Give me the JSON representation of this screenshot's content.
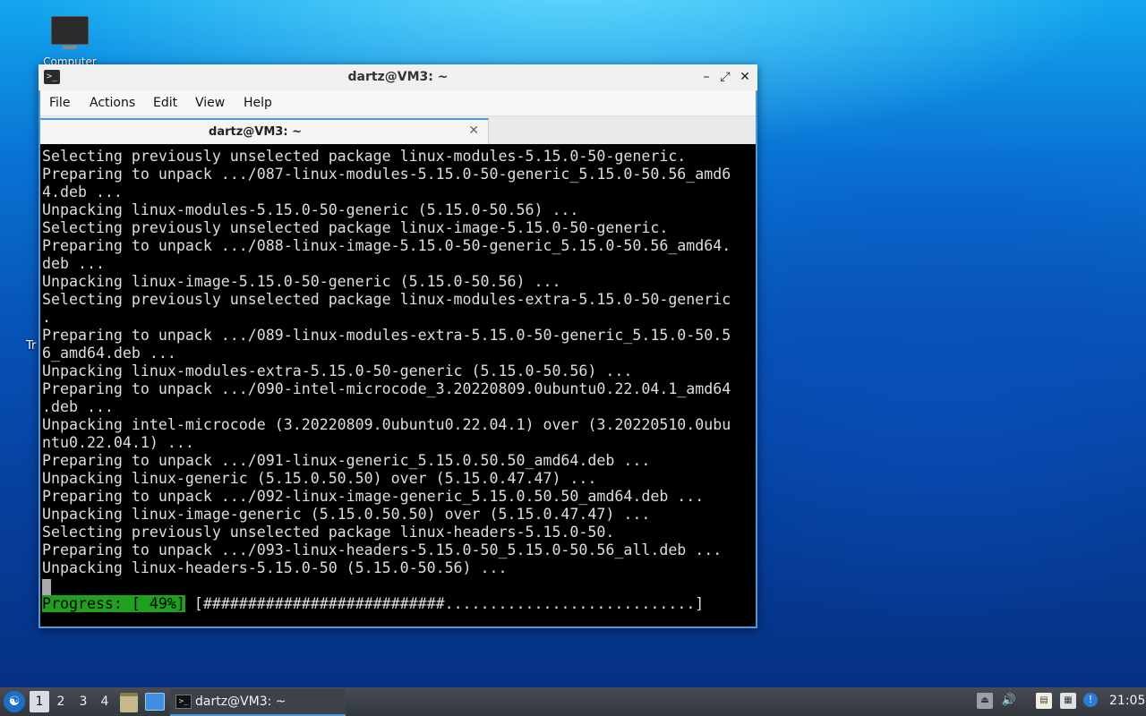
{
  "desktop": {
    "computer_label": "Computer",
    "trash_label": "Tr"
  },
  "window": {
    "title": "dartz@VM3: ~",
    "app_icon_glyph": ">_",
    "controls": {
      "minimize": "–",
      "maximize": "⤢",
      "close": "✕"
    },
    "menu": {
      "file": "File",
      "actions": "Actions",
      "edit": "Edit",
      "view": "View",
      "help": "Help"
    },
    "tab": {
      "title": "dartz@VM3: ~",
      "close": "✕"
    }
  },
  "terminal": {
    "lines": [
      "Selecting previously unselected package linux-modules-5.15.0-50-generic.",
      "Preparing to unpack .../087-linux-modules-5.15.0-50-generic_5.15.0-50.56_amd6",
      "4.deb ...",
      "Unpacking linux-modules-5.15.0-50-generic (5.15.0-50.56) ...",
      "Selecting previously unselected package linux-image-5.15.0-50-generic.",
      "Preparing to unpack .../088-linux-image-5.15.0-50-generic_5.15.0-50.56_amd64.",
      "deb ...",
      "Unpacking linux-image-5.15.0-50-generic (5.15.0-50.56) ...",
      "Selecting previously unselected package linux-modules-extra-5.15.0-50-generic",
      ".",
      "Preparing to unpack .../089-linux-modules-extra-5.15.0-50-generic_5.15.0-50.5",
      "6_amd64.deb ...",
      "Unpacking linux-modules-extra-5.15.0-50-generic (5.15.0-50.56) ...",
      "Preparing to unpack .../090-intel-microcode_3.20220809.0ubuntu0.22.04.1_amd64",
      ".deb ...",
      "Unpacking intel-microcode (3.20220809.0ubuntu0.22.04.1) over (3.20220510.0ubu",
      "ntu0.22.04.1) ...",
      "Preparing to unpack .../091-linux-generic_5.15.0.50.50_amd64.deb ...",
      "Unpacking linux-generic (5.15.0.50.50) over (5.15.0.47.47) ...",
      "Preparing to unpack .../092-linux-image-generic_5.15.0.50.50_amd64.deb ...",
      "Unpacking linux-image-generic (5.15.0.50.50) over (5.15.0.47.47) ...",
      "Selecting previously unselected package linux-headers-5.15.0-50.",
      "Preparing to unpack .../093-linux-headers-5.15.0-50_5.15.0-50.56_all.deb ...",
      "Unpacking linux-headers-5.15.0-50 (5.15.0-50.56) ..."
    ],
    "progress_label": "Progress: [ 49%]",
    "progress_bar": " [###########################............................]",
    "progress_percent": 49
  },
  "taskbar": {
    "start_glyph": "☯",
    "workspaces": [
      "1",
      "2",
      "3",
      "4"
    ],
    "active_workspace": "1",
    "task_label": "dartz@VM3: ~",
    "task_icon_glyph": ">_",
    "tray": {
      "eject": "⏏",
      "volume": "🔊",
      "clipboard": "▤",
      "network": "▦",
      "updates": "!"
    },
    "clock": "21:05"
  },
  "colors": {
    "accent": "#4f97d6",
    "progress_green": "#1fa01f",
    "terminal_bg": "#000000",
    "terminal_fg": "#dedede"
  }
}
